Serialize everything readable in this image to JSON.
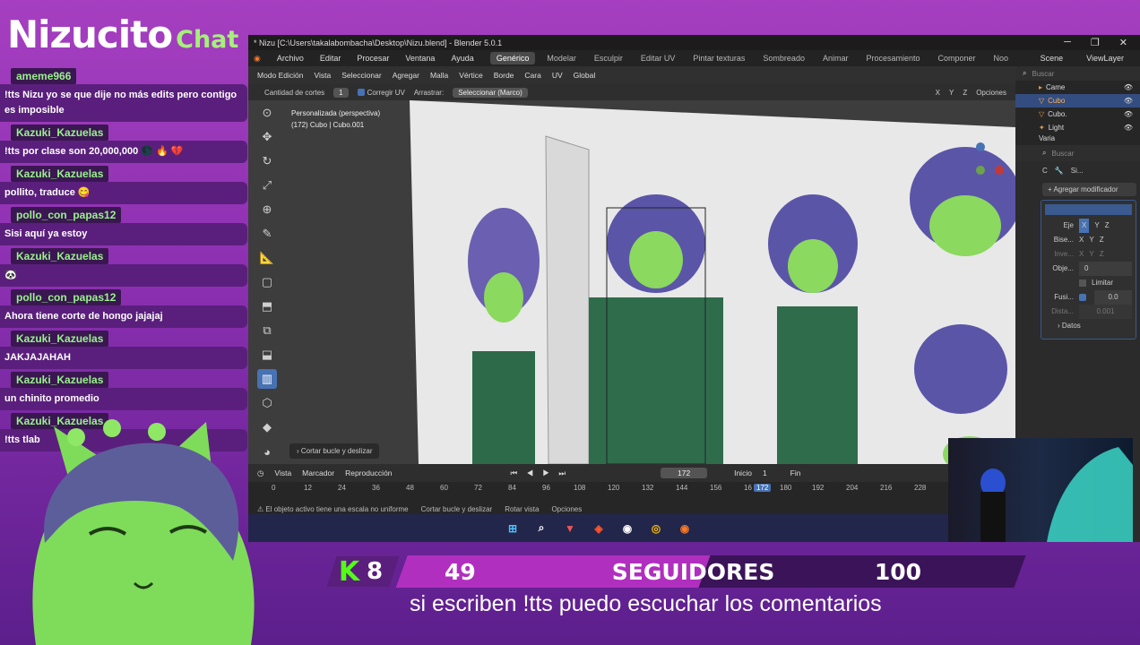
{
  "overlay": {
    "brand_name": "Nizucito",
    "brand_chat": "Chat",
    "chat": [
      {
        "user": "ameme966",
        "text": "!tts Nizu yo se que dije no más edits pero contigo es imposible"
      },
      {
        "user": "Kazuki_Kazuelas",
        "text": "!tts por clase son 20,000,000 🌑 🔥 💔"
      },
      {
        "user": "Kazuki_Kazuelas",
        "text": "pollito, traduce 😋"
      },
      {
        "user": "pollo_con_papas12",
        "text": "Sisi aquí ya estoy"
      },
      {
        "user": "Kazuki_Kazuelas",
        "text": "🐼"
      },
      {
        "user": "pollo_con_papas12",
        "text": "Ahora tiene corte de hongo jajajaj"
      },
      {
        "user": "Kazuki_Kazuelas",
        "text": "JAKJAJAHAH"
      },
      {
        "user": "Kazuki_Kazuelas",
        "text": "un chinito promedio"
      },
      {
        "user": "Kazuki_Kazuelas",
        "text": "!tts tlab"
      }
    ],
    "followers": {
      "platform_count": "8",
      "current": "49",
      "label": "SEGUIDORES",
      "goal": "100",
      "progress_fraction": 0.49
    },
    "subtitle": "si escriben !tts puedo escuchar los comentarios",
    "colors": {
      "accent": "#a6f07a",
      "kick": "#53fc18",
      "bar_fill": "#b02fbf",
      "bg": "#9b3bbd"
    }
  },
  "blender": {
    "title": "* Nizu [C:\\Users\\takalabombacha\\Desktop\\Nizu.blend] - Blender 5.0.1",
    "window_controls": [
      "─",
      "❐",
      "✕"
    ],
    "menus": [
      "Archivo",
      "Editar",
      "Procesar",
      "Ventana",
      "Ayuda"
    ],
    "workspaces": [
      "Genérico",
      "Modelar",
      "Esculpir",
      "Editar UV",
      "Pintar texturas",
      "Sombreado",
      "Animar",
      "Procesamiento",
      "Componer",
      "Noo"
    ],
    "scene": "Scene",
    "view_layer": "ViewLayer",
    "header": {
      "mode": "Modo Edición",
      "items": [
        "Vista",
        "Seleccionar",
        "Agregar",
        "Malla",
        "Vértice",
        "Borde",
        "Cara",
        "UV"
      ],
      "orientation": "Global"
    },
    "header2": {
      "cuts_label": "Cantidad de cortes",
      "cuts_value": "1",
      "correct_uv": "Corregir UV",
      "drag_label": "Arrastrar:",
      "drag_value": "Seleccionar (Marco)",
      "axes": [
        "X",
        "Y",
        "Z"
      ],
      "options": "Opciones"
    },
    "viewport_info": {
      "line1": "Personalizada (perspectiva)",
      "line2": "(172) Cubo | Cubo.001"
    },
    "operator_panel": "Cortar bucle y deslizar",
    "outliner": [
      {
        "name": "Came",
        "selected": false
      },
      {
        "name": "Cubo",
        "selected": true
      },
      {
        "name": "Cubo.",
        "selected": false
      },
      {
        "name": "Light",
        "selected": false
      },
      {
        "name": "Varia",
        "selected": false
      }
    ],
    "search_placeholder": "Buscar",
    "props": {
      "crumb_c": "C",
      "crumb_si": "Si...",
      "add_modifier": "Agregar modificador",
      "eje": "Eje",
      "bise": "Bise...",
      "inve": "Inve...",
      "obje": "Obje...",
      "limitar": "Limitar",
      "fusi": "Fusi...",
      "fusi_value": "0.0",
      "dista": "Dista...",
      "dista_value": "0.001",
      "datos": "Datos",
      "obj_value": "0",
      "xyz": [
        "X",
        "Y",
        "Z"
      ]
    },
    "timeline": {
      "view": "Vista",
      "marker": "Marcador",
      "playback": "Reproducción",
      "frame": "172",
      "start_label": "Inicio",
      "start": "1",
      "end_label": "Fin",
      "ticks": [
        "0",
        "12",
        "24",
        "36",
        "48",
        "60",
        "72",
        "84",
        "96",
        "108",
        "120",
        "132",
        "144",
        "156",
        "16",
        "172",
        "180",
        "192",
        "204",
        "216",
        "228"
      ]
    },
    "status": [
      "⚠ El objeto activo tiene una escala no uniforme",
      "Cortar bucle y deslizar",
      "Rotar vista",
      "Opciones"
    ]
  }
}
